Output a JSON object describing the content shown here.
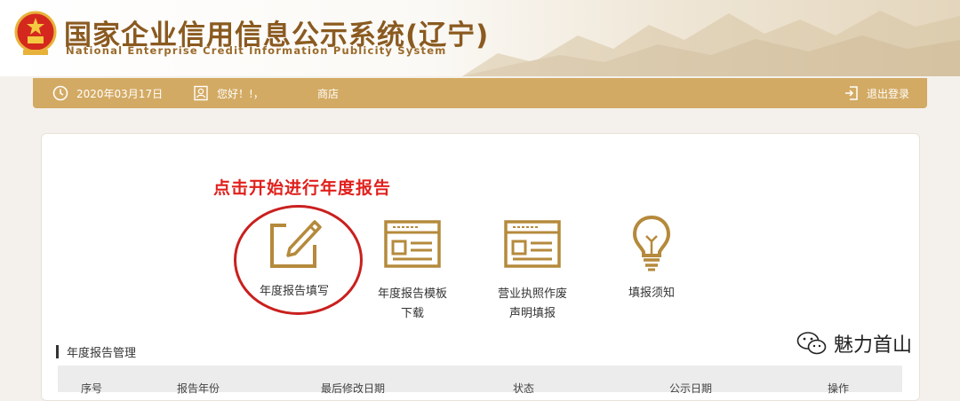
{
  "header": {
    "title_cn": "国家企业信用信息公示系统(辽宁)",
    "title_en": "National Enterprise Credit Information Publicity System"
  },
  "bar": {
    "date": "2020年03月17日",
    "greeting": "您好！!，",
    "company": "商店",
    "logout": "退出登录"
  },
  "annotation": {
    "hint": "点击开始进行年度报告"
  },
  "tiles": [
    {
      "label": "年度报告填写",
      "icon": "edit-report-icon"
    },
    {
      "label": "年度报告模板\n下载",
      "icon": "template-download-icon"
    },
    {
      "label": "营业执照作废\n声明填报",
      "icon": "license-void-icon"
    },
    {
      "label": "填报须知",
      "icon": "lightbulb-icon"
    }
  ],
  "section": {
    "title": "年度报告管理"
  },
  "table": {
    "headers": [
      "序号",
      "报告年份",
      "最后修改日期",
      "状态",
      "公示日期",
      "操作"
    ]
  },
  "watermark": {
    "text": "魅力首山",
    "icon": "wechat-icon"
  },
  "colors": {
    "gold": "#d3aa63",
    "brown": "#8a5a20",
    "red": "#e0201c"
  }
}
